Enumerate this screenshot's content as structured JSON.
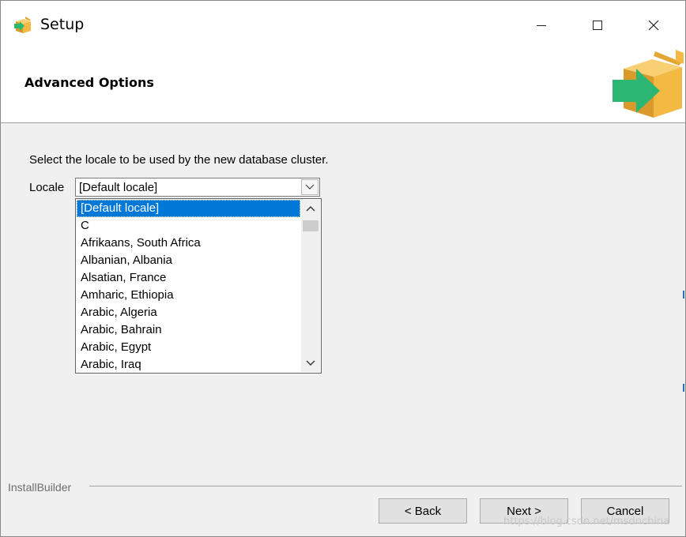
{
  "window": {
    "title": "Setup",
    "controls": {
      "minimize": "—",
      "maximize": "☐",
      "close": "✕"
    }
  },
  "header": {
    "title": "Advanced Options",
    "logo_icon": "box-arrow-icon"
  },
  "main": {
    "prompt": "Select the locale to be used by the new database cluster.",
    "locale_label": "Locale",
    "locale_value": "[Default locale]",
    "locale_options": [
      "[Default locale]",
      "C",
      "Afrikaans, South Africa",
      "Albanian, Albania",
      "Alsatian, France",
      "Amharic, Ethiopia",
      "Arabic, Algeria",
      "Arabic, Bahrain",
      "Arabic, Egypt",
      "Arabic, Iraq"
    ],
    "selected_option_index": 0
  },
  "footer": {
    "group_label": "InstallBuilder",
    "back_label": "< Back",
    "next_label": "Next >",
    "cancel_label": "Cancel"
  },
  "watermark": "https://blog.csdn.net/msdnchina",
  "colors": {
    "selection": "#0078d7",
    "logo_box": "#f4b942",
    "logo_arrow": "#2bb673"
  }
}
